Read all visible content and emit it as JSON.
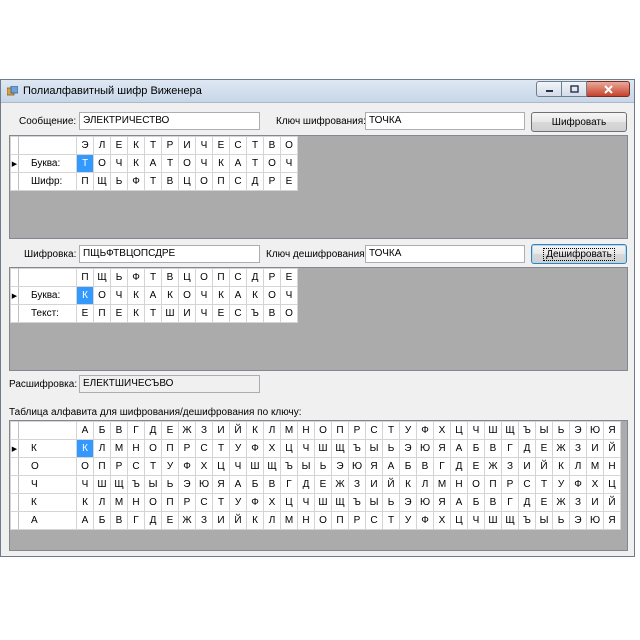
{
  "window": {
    "title": "Полиалфавитный шифр Виженера"
  },
  "encrypt": {
    "message_label": "Сообщение:",
    "message_value": "ЭЛЕКТРИЧЕСТВО",
    "key_label": "Ключ шифрования:",
    "key_value": "ТОЧКА",
    "button_label": "Шифровать",
    "grid": {
      "columns": [
        "Э",
        "Л",
        "Е",
        "К",
        "Т",
        "Р",
        "И",
        "Ч",
        "Е",
        "С",
        "Т",
        "В",
        "О"
      ],
      "rows": [
        {
          "label": "Буква:",
          "cells": [
            "Т",
            "О",
            "Ч",
            "К",
            "А",
            "Т",
            "О",
            "Ч",
            "К",
            "А",
            "Т",
            "О",
            "Ч"
          ]
        },
        {
          "label": "Шифр:",
          "cells": [
            "П",
            "Щ",
            "Ь",
            "Ф",
            "Т",
            "В",
            "Ц",
            "О",
            "П",
            "С",
            "Д",
            "Р",
            "Е"
          ]
        }
      ]
    }
  },
  "decrypt": {
    "cipher_label": "Шифровка:",
    "cipher_value": "ПЩЬФТВЦОПСДРЕ",
    "key_label": "Ключ дешифрования:",
    "key_value": "ТОЧКА",
    "button_label": "Дешифровать",
    "grid": {
      "columns": [
        "П",
        "Щ",
        "Ь",
        "Ф",
        "Т",
        "В",
        "Ц",
        "О",
        "П",
        "С",
        "Д",
        "Р",
        "Е"
      ],
      "rows": [
        {
          "label": "Буква:",
          "cells": [
            "К",
            "О",
            "Ч",
            "К",
            "А",
            "К",
            "О",
            "Ч",
            "К",
            "А",
            "К",
            "О",
            "Ч"
          ]
        },
        {
          "label": "Текст:",
          "cells": [
            "Е",
            "П",
            "Е",
            "К",
            "Т",
            "Ш",
            "И",
            "Ч",
            "Е",
            "С",
            "Ъ",
            "В",
            "О"
          ]
        }
      ]
    }
  },
  "result": {
    "label": "Расшифровка:",
    "value": "ЕЛЕКТШИЧЕСЪВО"
  },
  "table": {
    "caption": "Таблица алфавита для шифрования/дешифрования по ключу:",
    "columns": [
      "А",
      "Б",
      "В",
      "Г",
      "Д",
      "Е",
      "Ж",
      "З",
      "И",
      "Й",
      "К",
      "Л",
      "М",
      "Н",
      "О",
      "П",
      "Р",
      "С",
      "Т",
      "У",
      "Ф",
      "Х",
      "Ц",
      "Ч",
      "Ш",
      "Щ",
      "Ъ",
      "Ы",
      "Ь",
      "Э",
      "Ю",
      "Я"
    ],
    "rows": [
      {
        "label": "К",
        "cells": [
          "К",
          "Л",
          "М",
          "Н",
          "О",
          "П",
          "Р",
          "С",
          "Т",
          "У",
          "Ф",
          "Х",
          "Ц",
          "Ч",
          "Ш",
          "Щ",
          "Ъ",
          "Ы",
          "Ь",
          "Э",
          "Ю",
          "Я",
          "А",
          "Б",
          "В",
          "Г",
          "Д",
          "Е",
          "Ж",
          "З",
          "И",
          "Й"
        ]
      },
      {
        "label": "О",
        "cells": [
          "О",
          "П",
          "Р",
          "С",
          "Т",
          "У",
          "Ф",
          "Х",
          "Ц",
          "Ч",
          "Ш",
          "Щ",
          "Ъ",
          "Ы",
          "Ь",
          "Э",
          "Ю",
          "Я",
          "А",
          "Б",
          "В",
          "Г",
          "Д",
          "Е",
          "Ж",
          "З",
          "И",
          "Й",
          "К",
          "Л",
          "М",
          "Н"
        ]
      },
      {
        "label": "Ч",
        "cells": [
          "Ч",
          "Ш",
          "Щ",
          "Ъ",
          "Ы",
          "Ь",
          "Э",
          "Ю",
          "Я",
          "А",
          "Б",
          "В",
          "Г",
          "Д",
          "Е",
          "Ж",
          "З",
          "И",
          "Й",
          "К",
          "Л",
          "М",
          "Н",
          "О",
          "П",
          "Р",
          "С",
          "Т",
          "У",
          "Ф",
          "Х",
          "Ц"
        ]
      },
      {
        "label": "К",
        "cells": [
          "К",
          "Л",
          "М",
          "Н",
          "О",
          "П",
          "Р",
          "С",
          "Т",
          "У",
          "Ф",
          "Х",
          "Ц",
          "Ч",
          "Ш",
          "Щ",
          "Ъ",
          "Ы",
          "Ь",
          "Э",
          "Ю",
          "Я",
          "А",
          "Б",
          "В",
          "Г",
          "Д",
          "Е",
          "Ж",
          "З",
          "И",
          "Й"
        ]
      },
      {
        "label": "А",
        "cells": [
          "А",
          "Б",
          "В",
          "Г",
          "Д",
          "Е",
          "Ж",
          "З",
          "И",
          "Й",
          "К",
          "Л",
          "М",
          "Н",
          "О",
          "П",
          "Р",
          "С",
          "Т",
          "У",
          "Ф",
          "Х",
          "Ц",
          "Ч",
          "Ш",
          "Щ",
          "Ъ",
          "Ы",
          "Ь",
          "Э",
          "Ю",
          "Я"
        ]
      }
    ]
  }
}
